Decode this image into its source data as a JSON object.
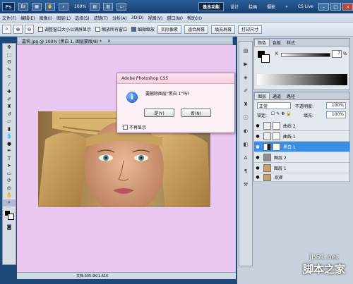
{
  "titlebar": {
    "logo": "Ps",
    "zoom": "100%",
    "workspaces": [
      "基本功能",
      "设计",
      "绘画",
      "摄影"
    ],
    "active_workspace": "基本功能",
    "overflow": "»",
    "cs_live": "CS Live"
  },
  "menu": [
    "文件(F)",
    "编辑(E)",
    "图像(I)",
    "图层(L)",
    "选择(S)",
    "滤镜(T)",
    "分析(A)",
    "3D(D)",
    "视图(V)",
    "窗口(W)",
    "帮助(H)"
  ],
  "options": {
    "resize_windows": "调整窗口大小以满屏显示",
    "zoom_all": "缩放所有窗口",
    "scrubby": "细微缩放",
    "actual_pixels": "实际像素",
    "fit_screen": "适合屏幕",
    "fill_screen": "填充屏幕",
    "print_size": "打印尺寸"
  },
  "document": {
    "tab_label": "嘉宾.jpg @ 100% (黑白 1, 图层蒙版/8) *",
    "status": "文档:305.9K/1.61K"
  },
  "color_panel": {
    "tabs": [
      "颜色",
      "色板",
      "样式"
    ],
    "slider_label": "K",
    "value": "7",
    "unit": "%"
  },
  "layers_panel": {
    "tabs": [
      "图层",
      "通道",
      "路径"
    ],
    "blend_mode": "正常",
    "opacity_label": "不透明度:",
    "opacity": "100%",
    "lock_label": "锁定:",
    "fill_label": "填充:",
    "fill": "100%",
    "layers": [
      {
        "name": "曲线 2",
        "selected": false,
        "visible": true
      },
      {
        "name": "曲线 1",
        "selected": false,
        "visible": true
      },
      {
        "name": "黑白 1",
        "selected": true,
        "visible": true
      },
      {
        "name": "图层 2",
        "selected": false,
        "visible": true
      },
      {
        "name": "图层 1",
        "selected": false,
        "visible": true
      },
      {
        "name": "背景",
        "selected": false,
        "visible": true
      }
    ]
  },
  "dialog": {
    "title": "Adobe Photoshop CS5",
    "message": "要删除图层\"黑白 1\"吗?",
    "yes": "是(Y)",
    "no": "否(N)",
    "dont_show": "不再显示"
  },
  "watermark": {
    "site": "jb51.net",
    "name": "脚本之家"
  }
}
